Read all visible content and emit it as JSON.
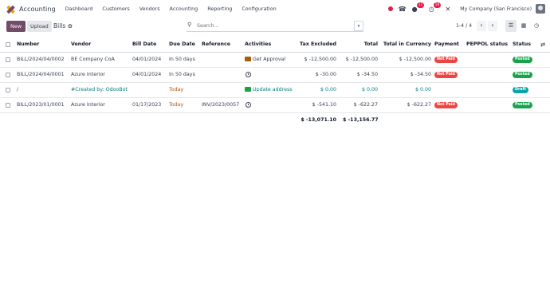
{
  "nav": {
    "app_name": "Accounting",
    "menu": [
      "Dashboard",
      "Customers",
      "Vendors",
      "Accounting",
      "Reporting",
      "Configuration"
    ],
    "chat_badge": "11",
    "activity_badge": "16",
    "company": "My Company (San Francisco)"
  },
  "control": {
    "new_label": "New",
    "upload_label": "Upload",
    "title": "Bills",
    "search_placeholder": "Search...",
    "pager": "1-4 / 4"
  },
  "columns": {
    "number": "Number",
    "vendor": "Vendor",
    "bill_date": "Bill Date",
    "due_date": "Due Date",
    "reference": "Reference",
    "activities": "Activities",
    "tax_excluded": "Tax Excluded",
    "total": "Total",
    "total_currency": "Total in Currency",
    "payment": "Payment",
    "peppol": "PEPPOL status",
    "status": "Status"
  },
  "rows": [
    {
      "number": "BILL/2024/04/0002",
      "vendor": "BE Company CoA",
      "bill_date": "04/01/2024",
      "due_date": "In 50 days",
      "reference": "",
      "activity": "Get Approval",
      "tax_excluded": "$ -12,500.00",
      "total": "$ -12,500.00",
      "total_currency": "$ -12,500.00",
      "payment": "Not Paid",
      "status": "Posted"
    },
    {
      "number": "BILL/2024/04/0001",
      "vendor": "Azure Interior",
      "bill_date": "04/01/2024",
      "due_date": "In 50 days",
      "reference": "",
      "activity": "",
      "tax_excluded": "$ -30.00",
      "total": "$ -34.50",
      "total_currency": "$ -34.50",
      "payment": "Not Paid",
      "status": "Posted"
    },
    {
      "number": "/",
      "vendor": "#Created by: OdooBot",
      "bill_date": "",
      "due_date": "Today",
      "reference": "",
      "activity": "Update address",
      "tax_excluded": "$ 0.00",
      "total": "$ 0.00",
      "total_currency": "$ 0.00",
      "payment": "",
      "status": "Draft"
    },
    {
      "number": "BILL/2023/01/0001",
      "vendor": "Azure Interior",
      "bill_date": "01/17/2023",
      "due_date": "Today",
      "reference": "INV/2023/0057",
      "activity": "",
      "tax_excluded": "$ -541.10",
      "total": "$ -622.27",
      "total_currency": "$ -622.27",
      "payment": "Not Paid",
      "status": "Posted"
    }
  ],
  "totals": {
    "tax_excluded": "$ -13,071.10",
    "total": "$ -13,156.77"
  },
  "colors": {
    "brand": "#714b67",
    "not_paid": "#ef4444",
    "posted": "#16a34a",
    "draft": "#0ea5a9",
    "link": "#017e84"
  }
}
